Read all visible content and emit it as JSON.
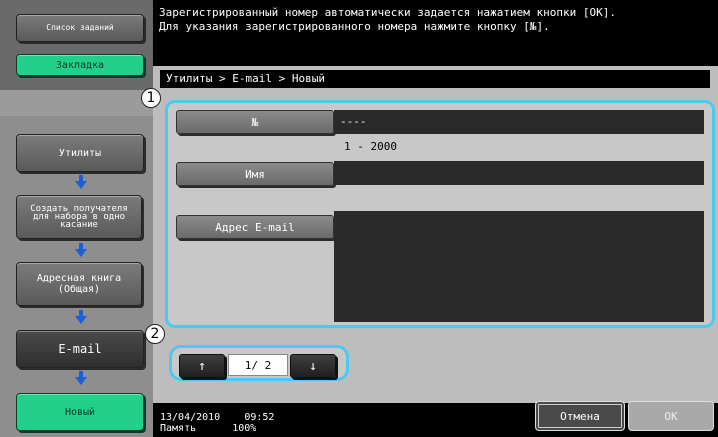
{
  "message": {
    "line1": "Зарегистрированный номер автоматически задается нажатием кнопки [OK].",
    "line2": "Для указания зарегистрированного номера нажмите кнопку [№]."
  },
  "sidebar": {
    "job_list_label": "Список заданий",
    "bookmark_label": "Закладка",
    "steps": [
      {
        "label": "Утилиты"
      },
      {
        "label": "Создать получателя для набора в одно касание"
      },
      {
        "label": "Адресная книга (Общая)"
      },
      {
        "label": "E-mail"
      },
      {
        "label": "Новый"
      }
    ]
  },
  "breadcrumb": "Утилиты > E-mail > Новый",
  "form": {
    "number_label": "№",
    "number_value": "----",
    "number_range": "1 - 2000",
    "name_label": "Имя",
    "name_value": "",
    "email_label": "Адрес E-mail",
    "email_value": ""
  },
  "pager": {
    "up_icon": "↑",
    "down_icon": "↓",
    "page": "1/ 2"
  },
  "callouts": [
    "1",
    "2"
  ],
  "status": {
    "date": "13/04/2010",
    "time": "09:52",
    "memory_label": "Память",
    "memory_value": "100%"
  },
  "buttons": {
    "cancel": "Отмена",
    "ok": "OK"
  },
  "colors": {
    "accent_green": "#22cf8b",
    "highlight_blue": "#4fc8f0",
    "arrow_blue": "#1a5fd8"
  }
}
